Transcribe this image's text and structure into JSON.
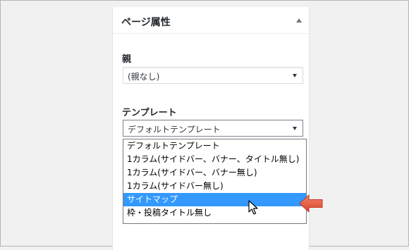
{
  "panel": {
    "title": "ページ属性"
  },
  "parent": {
    "label": "親",
    "selected": "(親なし)"
  },
  "template": {
    "label": "テンプレート",
    "selected": "デフォルトテンプレート",
    "options": [
      "デフォルトテンプレート",
      "1カラム(サイドバー、バナー、タイトル無し)",
      "1カラム(サイドバー、バナー無し)",
      "1カラム(サイドバー無し)",
      "サイトマップ",
      "枠・投稿タイトル無し"
    ],
    "highlighted_option": "サイトマップ"
  },
  "colors": {
    "highlight": "#3399ff",
    "annotation_arrow": "#e8583c"
  },
  "icons": [
    "chevron-up-icon",
    "dropdown-arrow-icon",
    "mouse-cursor-icon",
    "annotation-arrow-icon"
  ]
}
